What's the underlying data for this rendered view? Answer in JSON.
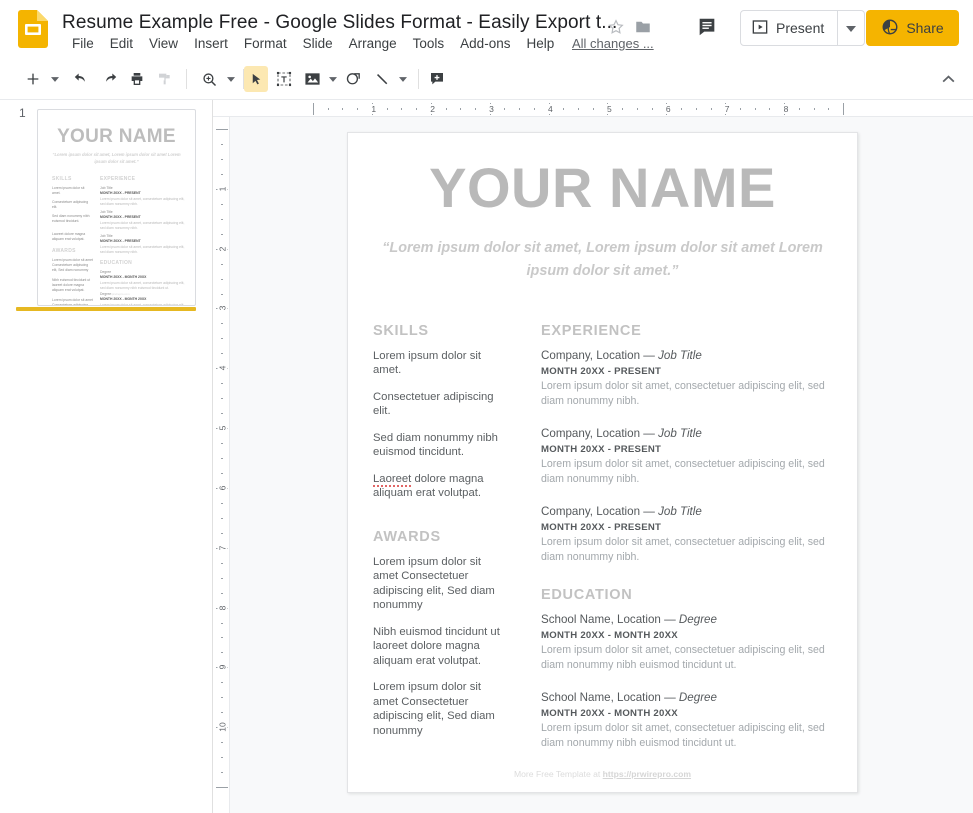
{
  "app": {
    "logo_icon": "google-slides-logo",
    "title": "Resume Example Free - Google Slides Format - Easily Export t...",
    "star_icon": "star-outline-icon",
    "folder_icon": "folder-icon",
    "comment_icon": "comment-icon",
    "save_status": "All changes ...",
    "present_label": "Present",
    "present_icon": "present-play-icon",
    "present_caret_icon": "chevron-down-icon",
    "share_label": "Share",
    "share_icon": "globe-icon",
    "share_color": "#f5b400",
    "accent_color": "#e6b822"
  },
  "menubar": {
    "items": [
      {
        "label": "File"
      },
      {
        "label": "Edit"
      },
      {
        "label": "View"
      },
      {
        "label": "Insert"
      },
      {
        "label": "Format"
      },
      {
        "label": "Slide"
      },
      {
        "label": "Arrange"
      },
      {
        "label": "Tools"
      },
      {
        "label": "Add-ons"
      },
      {
        "label": "Help"
      }
    ]
  },
  "toolbar": {
    "items": [
      {
        "name": "new-slide-button",
        "icon": "plus-icon"
      },
      {
        "name": "new-slide-dropdown",
        "icon": "caret-down-icon"
      },
      {
        "name": "undo-button",
        "icon": "undo-arrow-icon"
      },
      {
        "name": "redo-button",
        "icon": "redo-arrow-icon"
      },
      {
        "name": "print-button",
        "icon": "printer-icon"
      },
      {
        "name": "paint-format-button",
        "icon": "paint-roller-icon"
      },
      {
        "name": "zoom-button",
        "icon": "magnifier-plus-icon"
      },
      {
        "name": "zoom-dropdown",
        "icon": "caret-down-icon"
      },
      {
        "name": "select-tool-button",
        "icon": "cursor-arrow-icon"
      },
      {
        "name": "text-box-button",
        "icon": "text-box-icon"
      },
      {
        "name": "insert-image-button",
        "icon": "image-icon"
      },
      {
        "name": "insert-image-dropdown",
        "icon": "caret-down-icon"
      },
      {
        "name": "shape-button",
        "icon": "shape-circle-icon"
      },
      {
        "name": "line-button",
        "icon": "line-icon"
      },
      {
        "name": "line-dropdown",
        "icon": "caret-down-icon"
      },
      {
        "name": "add-comment-button",
        "icon": "comment-plus-icon"
      }
    ],
    "collapse_icon": "chevron-up-icon"
  },
  "filmstrip": {
    "slide_number": "1"
  },
  "rulers": {
    "horizontal_labels": [
      "1",
      "2",
      "3",
      "4",
      "5",
      "6",
      "7",
      "8"
    ],
    "vertical_labels": [
      "1",
      "2",
      "3",
      "4",
      "5",
      "6",
      "7",
      "8",
      "9",
      "10"
    ]
  },
  "slide": {
    "name": "YOUR NAME",
    "quote": "“Lorem ipsum dolor sit amet, Lorem ipsum dolor sit amet Lorem ipsum dolor sit amet.”",
    "skills": {
      "heading": "SKILLS",
      "items": [
        "Lorem ipsum dolor sit amet.",
        "Consectetuer adipiscing elit.",
        "Sed diam nonummy nibh euismod tincidunt.",
        "Laoreet dolore magna aliquam erat volutpat."
      ],
      "misspelled_word": "Laoreet"
    },
    "awards": {
      "heading": "AWARDS",
      "items": [
        "Lorem ipsum dolor sit amet Consectetuer adipiscing elit, Sed diam nonummy",
        "Nibh euismod tincidunt ut laoreet dolore magna aliquam erat volutpat.",
        "Lorem ipsum dolor sit amet Consectetuer adipiscing elit, Sed diam nonummy"
      ]
    },
    "experience": {
      "heading": "EXPERIENCE",
      "entries": [
        {
          "org": "Company, Location — ",
          "role": "Job Title",
          "date": "MONTH 20XX - PRESENT",
          "desc": "Lorem ipsum dolor sit amet, consectetuer adipiscing elit, sed diam nonummy nibh."
        },
        {
          "org": "Company, Location — ",
          "role": "Job Title",
          "date": "MONTH 20XX - PRESENT",
          "desc": "Lorem ipsum dolor sit amet, consectetuer adipiscing elit, sed diam nonummy nibh."
        },
        {
          "org": "Company, Location — ",
          "role": "Job Title",
          "date": "MONTH 20XX - PRESENT",
          "desc": "Lorem ipsum dolor sit amet, consectetuer adipiscing elit, sed diam nonummy nibh."
        }
      ]
    },
    "education": {
      "heading": "EDUCATION",
      "entries": [
        {
          "org": "School Name, Location — ",
          "role": "Degree",
          "date": "MONTH 20XX - MONTH 20XX",
          "desc": "Lorem ipsum dolor sit amet, consectetuer adipiscing elit, sed diam nonummy nibh euismod tincidunt ut."
        },
        {
          "org": "School Name, Location — ",
          "role": "Degree",
          "date": "MONTH 20XX - MONTH 20XX",
          "desc": "Lorem ipsum dolor sit amet, consectetuer adipiscing elit, sed diam nonummy nibh euismod tincidunt ut."
        }
      ]
    },
    "footer_prefix": "More Free Template at ",
    "footer_link": "https://prwirepro.com"
  }
}
